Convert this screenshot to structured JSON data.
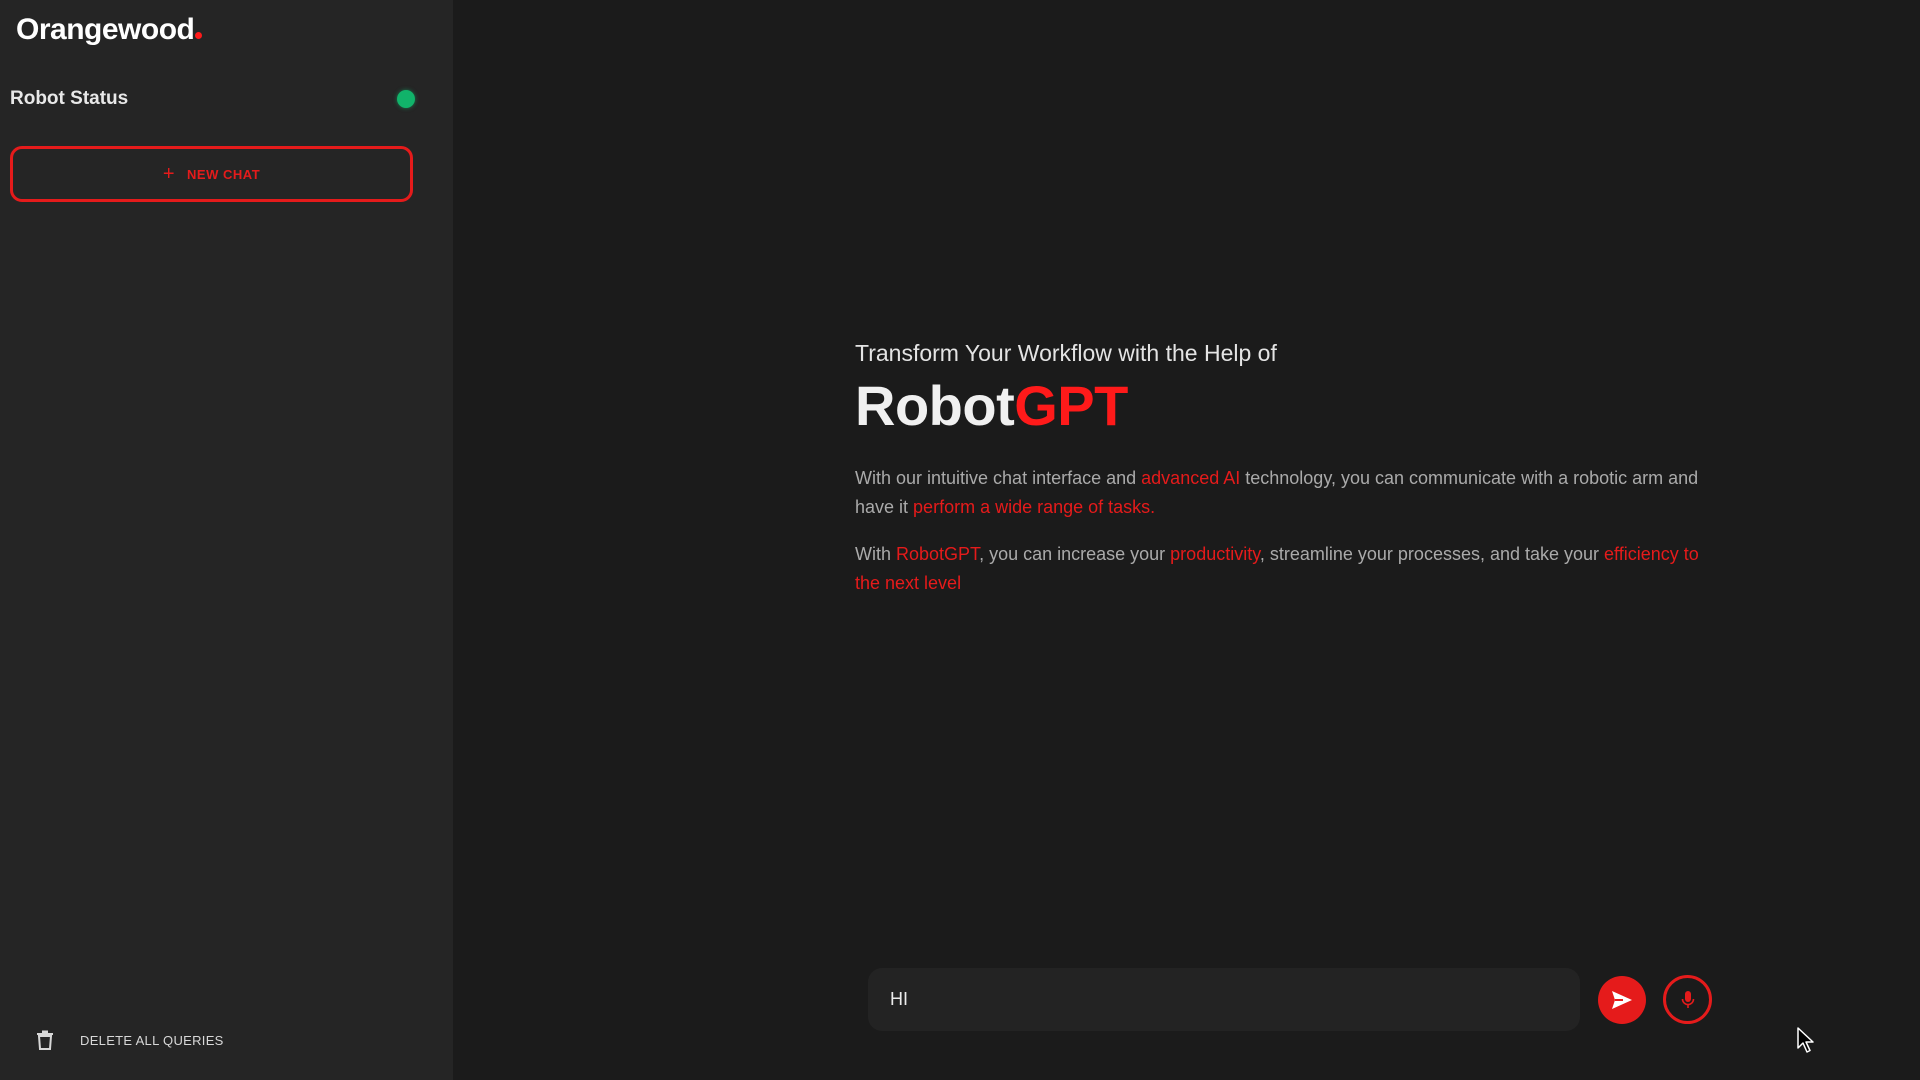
{
  "sidebar": {
    "logo": "Orangewood",
    "robot_status_label": "Robot Status",
    "new_chat_label": "NEW CHAT",
    "delete_all_label": "DELETE ALL QUERIES"
  },
  "hero": {
    "subtitle": "Transform Your Workflow with the Help of",
    "title_main": "Robot",
    "title_accent": "GPT",
    "para1": {
      "t1": "With our intuitive chat interface and ",
      "h1": "advanced AI",
      "t2": " technology, you can communicate with a robotic arm and have it ",
      "h2": "perform a wide range of tasks."
    },
    "para2": {
      "t1": "With ",
      "h1": "RobotGPT",
      "t2": ", you can increase your ",
      "h2": "productivity",
      "t3": ", streamline your processes, and take your ",
      "h3": "efficiency to the next level"
    }
  },
  "composer": {
    "input_value": "HI"
  },
  "colors": {
    "accent": "#e51b1b",
    "status_online": "#11b36a",
    "sidebar_bg": "#252525",
    "main_bg": "#1b1b1b"
  },
  "icons": {
    "plus": "plus-icon",
    "trash": "trash-icon",
    "send": "send-icon",
    "mic": "microphone-icon",
    "cursor": "mouse-cursor-icon"
  }
}
